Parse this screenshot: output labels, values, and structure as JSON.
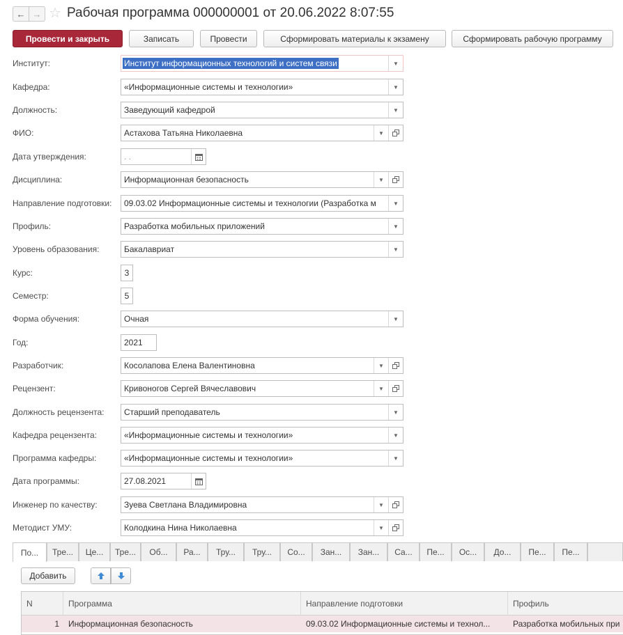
{
  "window": {
    "title": "Рабочая программа 000000001 от 20.06.2022 8:07:55",
    "back_glyph": "←",
    "forward_glyph": "→",
    "star_glyph": "☆"
  },
  "toolbar": {
    "post_close": "Провести и закрыть",
    "write": "Записать",
    "post": "Провести",
    "gen_exam": "Сформировать материалы к экзамену",
    "gen_program": "Сформировать рабочую программу"
  },
  "form": {
    "institute": {
      "label": "Институт:",
      "value": "Институт информационных технологий и систем связи"
    },
    "department": {
      "label": "Кафедра:",
      "value": "«Информационные системы и технологии»"
    },
    "position": {
      "label": "Должность:",
      "value": "Заведующий кафедрой"
    },
    "fio": {
      "label": "ФИО:",
      "value": "Астахова Татьяна Николаевна"
    },
    "approval_date": {
      "label": "Дата утверждения:",
      "value": " .  ."
    },
    "discipline": {
      "label": "Дисциплина:",
      "value": "Информационная безопасность"
    },
    "direction": {
      "label": "Направление подготовки:",
      "value": "09.03.02 Информационные системы и технологии (Разработка м"
    },
    "profile": {
      "label": "Профиль:",
      "value": "Разработка мобильных приложений"
    },
    "edu_level": {
      "label": "Уровень образования:",
      "value": "Бакалавриат"
    },
    "course": {
      "label": "Курс:",
      "value": "3"
    },
    "semester": {
      "label": "Семестр:",
      "value": "5"
    },
    "study_form": {
      "label": "Форма обучения:",
      "value": "Очная"
    },
    "year": {
      "label": "Год:",
      "value": "2021"
    },
    "developer": {
      "label": "Разработчик:",
      "value": "Косолапова Елена Валентиновна"
    },
    "reviewer": {
      "label": "Рецензент:",
      "value": "Кривоногов Сергей Вячеславович"
    },
    "reviewer_position": {
      "label": "Должность рецензента:",
      "value": "Старший преподаватель"
    },
    "reviewer_department": {
      "label": "Кафедра рецензента:",
      "value": "«Информационные системы и технологии»"
    },
    "program_department": {
      "label": "Программа кафедры:",
      "value": "«Информационные системы и технологии»"
    },
    "program_date": {
      "label": "Дата программы:",
      "value": "27.08.2021"
    },
    "quality_engineer": {
      "label": "Инженер по качеству:",
      "value": "Зуева Светлана Владимировна"
    },
    "methodist": {
      "label": "Методист УМУ:",
      "value": "Колодкина Нина Николаевна"
    }
  },
  "tabs": [
    "По...",
    "Тре...",
    "Це...",
    "Тре...",
    "Об...",
    "Ра...",
    "Тру...",
    "Тру...",
    "Со...",
    "Зан...",
    "Зан...",
    "Са...",
    "Пе...",
    "Ос...",
    "До...",
    "Пе...",
    "Пе..."
  ],
  "subtoolbar": {
    "add": "Добавить"
  },
  "table": {
    "headers": {
      "n": "N",
      "program": "Программа",
      "direction": "Направление подготовки",
      "profile": "Профиль"
    },
    "rows": [
      {
        "n": "1",
        "program": "Информационная безопасность",
        "direction": "09.03.02 Информационные системы и технол...",
        "profile": "Разработка мобильных при"
      }
    ]
  },
  "colors": {
    "primary": "#a8283a",
    "selection": "#3d6fc4",
    "row_highlight": "#f3e3e6"
  }
}
